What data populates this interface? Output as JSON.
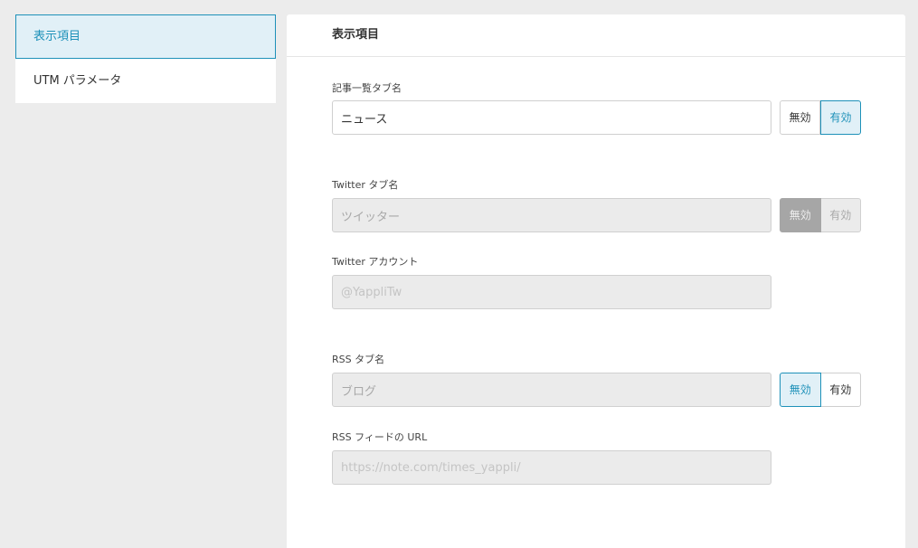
{
  "sidebar": {
    "items": [
      {
        "label": "表示項目",
        "active": true
      },
      {
        "label": "UTM パラメータ",
        "active": false
      }
    ]
  },
  "panel": {
    "title": "表示項目",
    "article_tab": {
      "label": "記事一覧タブ名",
      "value": "ニュース",
      "toggle": {
        "off_label": "無効",
        "on_label": "有効",
        "selected": "有効"
      }
    },
    "twitter_tab": {
      "label": "Twitter タブ名",
      "value": "ツイッター",
      "toggle": {
        "off_label": "無効",
        "on_label": "有効",
        "selected": "無効"
      }
    },
    "twitter_account": {
      "label": "Twitter アカウント",
      "placeholder": "@YappliTw"
    },
    "rss_tab": {
      "label": "RSS タブ名",
      "value": "ブログ",
      "toggle": {
        "off_label": "無効",
        "on_label": "有効",
        "selected": "無効"
      }
    },
    "rss_feed": {
      "label": "RSS フィードの URL",
      "placeholder": "https://note.com/times_yappli/"
    }
  },
  "colors": {
    "accent": "#1e91b9",
    "accent_bg": "#e1f0f7",
    "disabled_bg": "#ebebeb"
  }
}
